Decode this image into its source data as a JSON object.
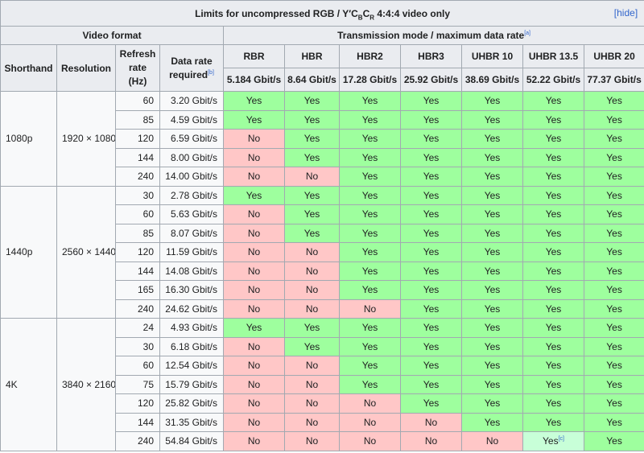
{
  "caption": {
    "pre": "Limits for uncompressed RGB / Y′C",
    "sub1": "B",
    "mid": "C",
    "sub2": "R",
    "post": " 4:4:4 video only",
    "hide_label": "[hide]"
  },
  "headers": {
    "video_format": "Video format",
    "transmission": "Transmission mode / maximum data rate",
    "transmission_ref": "[a]",
    "shorthand": "Shorthand",
    "resolution": "Resolution",
    "refresh": "Refresh rate (Hz)",
    "data_rate": "Data rate required",
    "data_rate_ref": "[b]"
  },
  "modes": [
    {
      "name": "RBR",
      "rate": "5.184 Gbit/s"
    },
    {
      "name": "HBR",
      "rate": "8.64 Gbit/s"
    },
    {
      "name": "HBR2",
      "rate": "17.28 Gbit/s"
    },
    {
      "name": "HBR3",
      "rate": "25.92 Gbit/s"
    },
    {
      "name": "UHBR 10",
      "rate": "38.69 Gbit/s"
    },
    {
      "name": "UHBR 13.5",
      "rate": "52.22 Gbit/s"
    },
    {
      "name": "UHBR 20",
      "rate": "77.37 Gbit/s"
    }
  ],
  "groups": [
    {
      "shorthand": "1080p",
      "resolution": "1920 × 1080",
      "rows": [
        {
          "refresh": "60",
          "rate": "3.20 Gbit/s",
          "cells": [
            "Yes",
            "Yes",
            "Yes",
            "Yes",
            "Yes",
            "Yes",
            "Yes"
          ]
        },
        {
          "refresh": "85",
          "rate": "4.59 Gbit/s",
          "cells": [
            "Yes",
            "Yes",
            "Yes",
            "Yes",
            "Yes",
            "Yes",
            "Yes"
          ]
        },
        {
          "refresh": "120",
          "rate": "6.59 Gbit/s",
          "cells": [
            "No",
            "Yes",
            "Yes",
            "Yes",
            "Yes",
            "Yes",
            "Yes"
          ]
        },
        {
          "refresh": "144",
          "rate": "8.00 Gbit/s",
          "cells": [
            "No",
            "Yes",
            "Yes",
            "Yes",
            "Yes",
            "Yes",
            "Yes"
          ]
        },
        {
          "refresh": "240",
          "rate": "14.00 Gbit/s",
          "cells": [
            "No",
            "No",
            "Yes",
            "Yes",
            "Yes",
            "Yes",
            "Yes"
          ]
        }
      ]
    },
    {
      "shorthand": "1440p",
      "resolution": "2560 × 1440",
      "rows": [
        {
          "refresh": "30",
          "rate": "2.78 Gbit/s",
          "cells": [
            "Yes",
            "Yes",
            "Yes",
            "Yes",
            "Yes",
            "Yes",
            "Yes"
          ]
        },
        {
          "refresh": "60",
          "rate": "5.63 Gbit/s",
          "cells": [
            "No",
            "Yes",
            "Yes",
            "Yes",
            "Yes",
            "Yes",
            "Yes"
          ]
        },
        {
          "refresh": "85",
          "rate": "8.07 Gbit/s",
          "cells": [
            "No",
            "Yes",
            "Yes",
            "Yes",
            "Yes",
            "Yes",
            "Yes"
          ]
        },
        {
          "refresh": "120",
          "rate": "11.59 Gbit/s",
          "cells": [
            "No",
            "No",
            "Yes",
            "Yes",
            "Yes",
            "Yes",
            "Yes"
          ]
        },
        {
          "refresh": "144",
          "rate": "14.08 Gbit/s",
          "cells": [
            "No",
            "No",
            "Yes",
            "Yes",
            "Yes",
            "Yes",
            "Yes"
          ]
        },
        {
          "refresh": "165",
          "rate": "16.30 Gbit/s",
          "cells": [
            "No",
            "No",
            "Yes",
            "Yes",
            "Yes",
            "Yes",
            "Yes"
          ]
        },
        {
          "refresh": "240",
          "rate": "24.62 Gbit/s",
          "cells": [
            "No",
            "No",
            "No",
            "Yes",
            "Yes",
            "Yes",
            "Yes"
          ]
        }
      ]
    },
    {
      "shorthand": "4K",
      "resolution": "3840 × 2160",
      "rows": [
        {
          "refresh": "24",
          "rate": "4.93 Gbit/s",
          "cells": [
            "Yes",
            "Yes",
            "Yes",
            "Yes",
            "Yes",
            "Yes",
            "Yes"
          ]
        },
        {
          "refresh": "30",
          "rate": "6.18 Gbit/s",
          "cells": [
            "No",
            "Yes",
            "Yes",
            "Yes",
            "Yes",
            "Yes",
            "Yes"
          ]
        },
        {
          "refresh": "60",
          "rate": "12.54 Gbit/s",
          "cells": [
            "No",
            "No",
            "Yes",
            "Yes",
            "Yes",
            "Yes",
            "Yes"
          ]
        },
        {
          "refresh": "75",
          "rate": "15.79 Gbit/s",
          "cells": [
            "No",
            "No",
            "Yes",
            "Yes",
            "Yes",
            "Yes",
            "Yes"
          ]
        },
        {
          "refresh": "120",
          "rate": "25.82 Gbit/s",
          "cells": [
            "No",
            "No",
            "No",
            "Yes",
            "Yes",
            "Yes",
            "Yes"
          ]
        },
        {
          "refresh": "144",
          "rate": "31.35 Gbit/s",
          "cells": [
            "No",
            "No",
            "No",
            "No",
            "Yes",
            "Yes",
            "Yes"
          ]
        },
        {
          "refresh": "240",
          "rate": "54.84 Gbit/s",
          "cells": [
            "No",
            "No",
            "No",
            "No",
            "No",
            "Yes[c]",
            "Yes"
          ]
        }
      ]
    }
  ]
}
